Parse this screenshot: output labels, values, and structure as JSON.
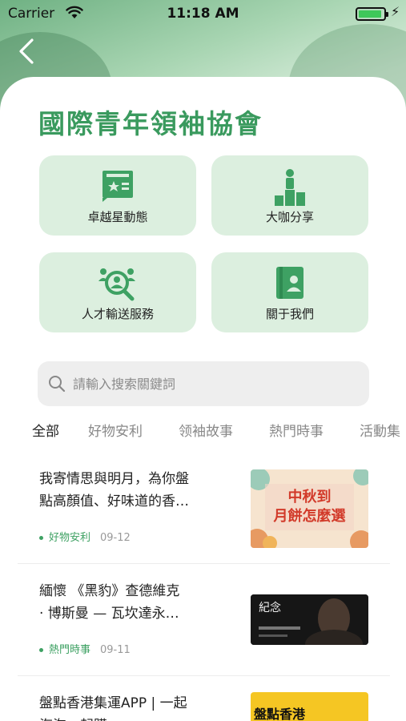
{
  "status_bar": {
    "carrier": "Carrier",
    "time": "11:18 AM"
  },
  "page": {
    "title": "國際青年領袖協會"
  },
  "tiles": [
    {
      "label": "卓越星動態",
      "icon": "news-card-icon"
    },
    {
      "label": "大咖分享",
      "icon": "podium-icon"
    },
    {
      "label": "人才輸送服務",
      "icon": "talent-search-icon"
    },
    {
      "label": "關于我們",
      "icon": "about-book-icon"
    }
  ],
  "search": {
    "placeholder": "請輸入搜索關鍵詞"
  },
  "tabs": [
    "全部",
    "好物安利",
    "领袖故事",
    "熱門時事",
    "活動集"
  ],
  "articles": [
    {
      "title_line1": "我寄情思與明月，為你盤",
      "title_line2": "點高顏值、好味道的香…",
      "category": "好物安利",
      "date": "09-12",
      "thumb_text1": "中秋到",
      "thumb_text2": "月餅怎麼選"
    },
    {
      "title_line1": "緬懷 《黑豹》查德維克",
      "title_line2": "· 博斯曼 — 瓦坎達永…",
      "category": "熱門時事",
      "date": "09-11",
      "thumb_text1": "紀念",
      "thumb_text2": ""
    },
    {
      "title_line1": "盤點香港集運APP | 一起",
      "title_line2": "海淘一起購",
      "category": "",
      "date": "",
      "thumb_text1": "盤點香港",
      "thumb_text2": ""
    }
  ],
  "colors": {
    "accent": "#3a9a5e",
    "tile_bg": "#dcefdf",
    "tab_active": "#222222",
    "tab_inactive": "#888888"
  }
}
